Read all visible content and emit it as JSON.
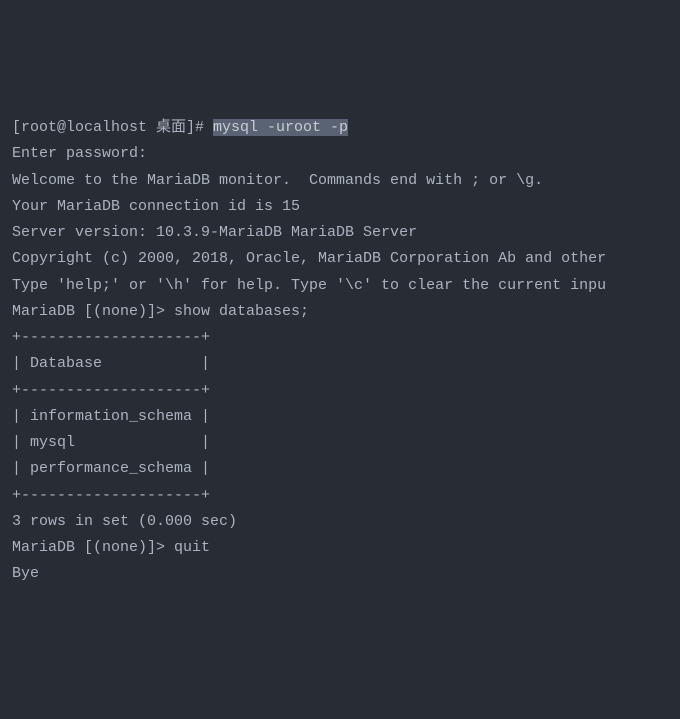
{
  "terminal": {
    "prompt": "[root@localhost 桌面]# ",
    "command": "mysql -uroot -p",
    "lines": {
      "enter_password": "Enter password:",
      "welcome": "Welcome to the MariaDB monitor.  Commands end with ; or \\g.",
      "connection_id": "Your MariaDB connection id is 15",
      "server_version": "Server version: 10.3.9-MariaDB MariaDB Server",
      "blank1": "",
      "copyright": "Copyright (c) 2000, 2018, Oracle, MariaDB Corporation Ab and other",
      "blank2": "",
      "help": "Type 'help;' or '\\h' for help. Type '\\c' to clear the current inpu",
      "blank3": "",
      "mariadb_prompt1": "MariaDB [(none)]> show databases;",
      "table_top": "+--------------------+",
      "table_header": "| Database           |",
      "table_sep1": "+--------------------+",
      "table_row1": "| information_schema |",
      "table_row2": "| mysql              |",
      "table_row3": "| performance_schema |",
      "table_bottom": "+--------------------+",
      "rows_result": "3 rows in set (0.000 sec)",
      "blank4": "",
      "mariadb_prompt2": "MariaDB [(none)]> quit",
      "bye": "Bye"
    }
  }
}
